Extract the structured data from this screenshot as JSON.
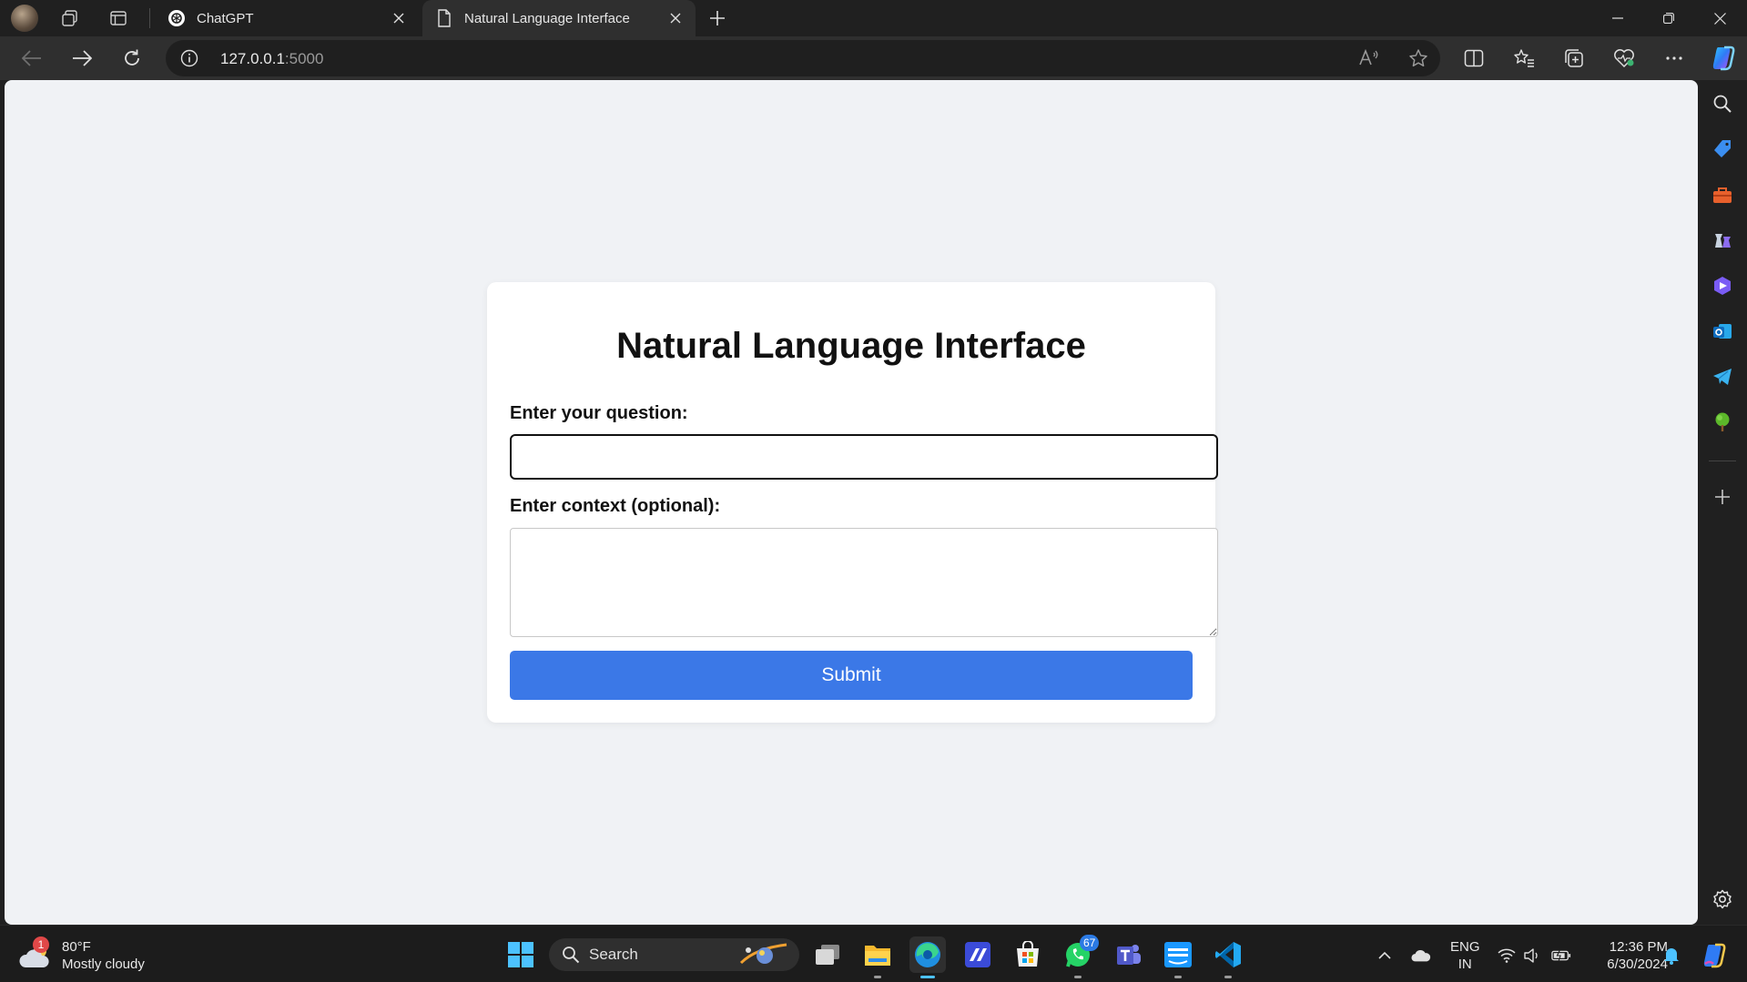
{
  "browser": {
    "tabs": [
      {
        "title": "ChatGPT",
        "active": false
      },
      {
        "title": "Natural Language Interface",
        "active": true
      }
    ],
    "address": {
      "host": "127.0.0.1",
      "port": ":5000"
    }
  },
  "page": {
    "title": "Natural Language Interface",
    "question_label": "Enter your question:",
    "question_value": "",
    "context_label": "Enter context (optional):",
    "context_value": "",
    "submit_label": "Submit"
  },
  "sidebar": {
    "icons": [
      "search-icon",
      "shopping-tag-icon",
      "toolbox-icon",
      "games-icon",
      "copilot-designer-icon",
      "outlook-icon",
      "telegram-icon",
      "tree-icon",
      "add-icon",
      "settings-icon"
    ]
  },
  "taskbar": {
    "weather": {
      "temp": "80°F",
      "condition": "Mostly cloudy",
      "badge": "1"
    },
    "search_label": "Search",
    "whatsapp_badge": "67",
    "language": {
      "line1": "ENG",
      "line2": "IN"
    },
    "clock": {
      "time": "12:36 PM",
      "date": "6/30/2024"
    }
  },
  "colors": {
    "accent": "#3b78e7",
    "page_bg": "#f0f2f5",
    "edge_active": "#4cc2ff"
  }
}
